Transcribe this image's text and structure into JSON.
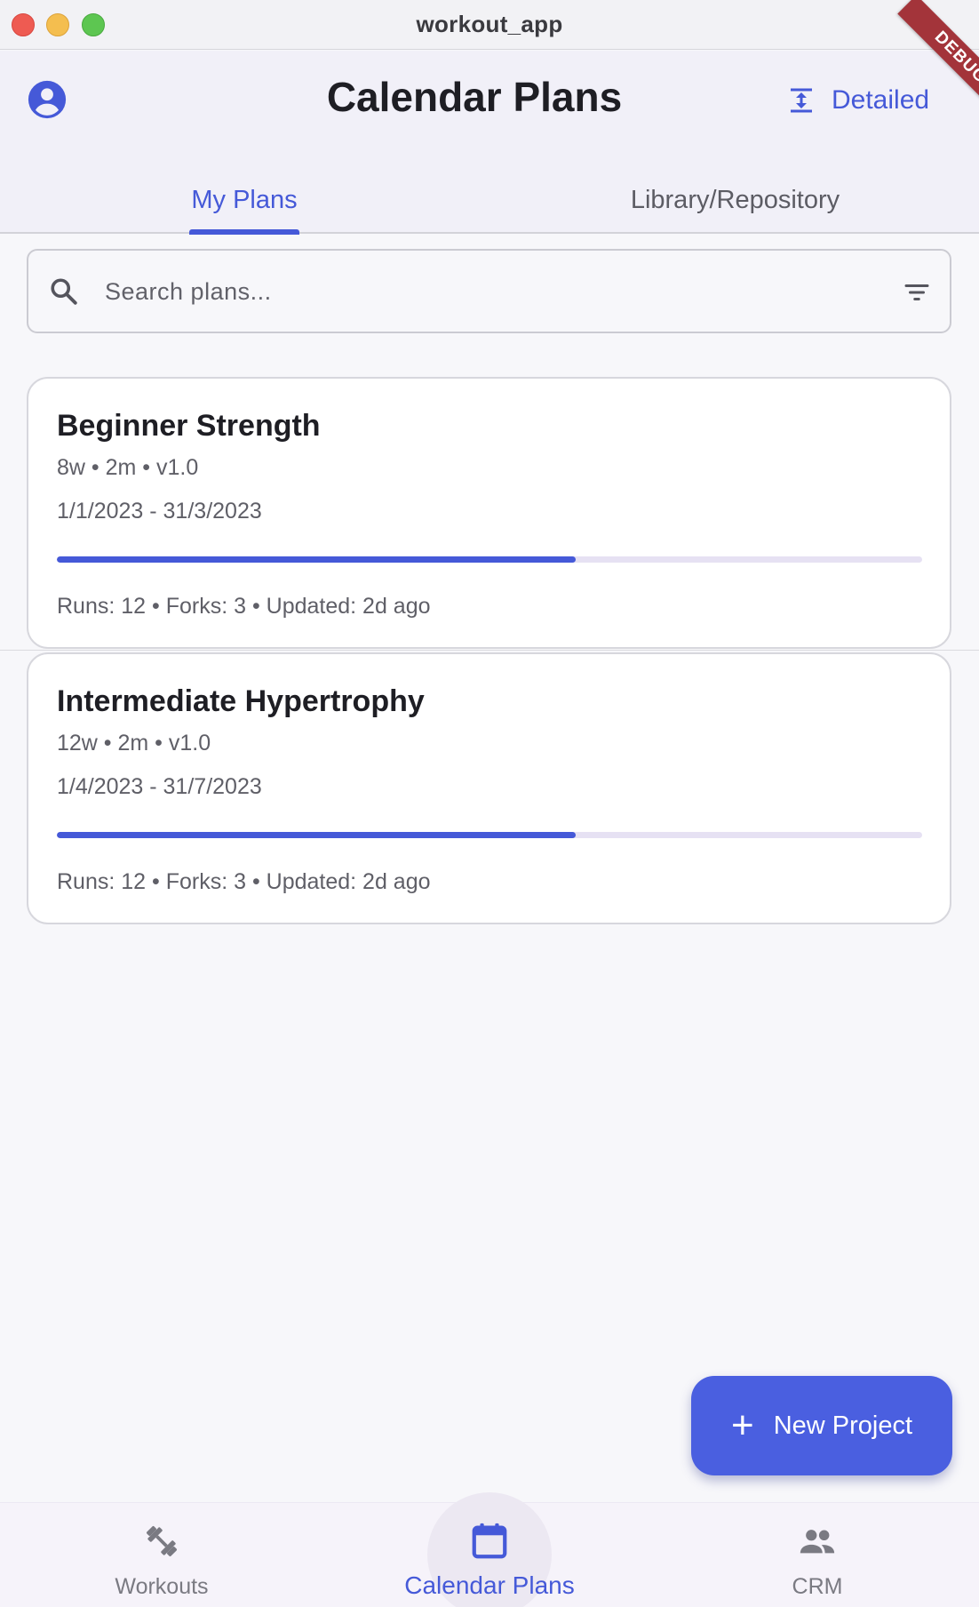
{
  "window": {
    "title": "workout_app"
  },
  "appbar": {
    "title": "Calendar Plans",
    "account_icon": "account-circle-icon",
    "detailed_label": "Detailed",
    "detailed_icon": "vertical-align-center-icon",
    "debug_banner": "DEBUG",
    "accent_color": "#4559d8"
  },
  "tabs": [
    {
      "label": "My Plans",
      "active": true
    },
    {
      "label": "Library/Repository",
      "active": false
    }
  ],
  "search": {
    "placeholder": "Search plans...",
    "value": ""
  },
  "plans": [
    {
      "title": "Beginner Strength",
      "meta": "8w • 2m • v1.0",
      "dates": "1/1/2023 - 31/3/2023",
      "progress": 0.6,
      "stats": "Runs: 12 • Forks: 3 • Updated: 2d ago"
    },
    {
      "title": "Intermediate Hypertrophy",
      "meta": "12w • 2m • v1.0",
      "dates": "1/4/2023 - 31/7/2023",
      "progress": 0.6,
      "stats": "Runs: 12 • Forks: 3 • Updated: 2d ago"
    }
  ],
  "fab": {
    "label": "New Project",
    "icon": "plus-icon"
  },
  "bottom_nav": [
    {
      "label": "Workouts",
      "icon": "dumbbell-icon",
      "active": false
    },
    {
      "label": "Calendar Plans",
      "icon": "calendar-icon",
      "active": true
    },
    {
      "label": "CRM",
      "icon": "people-icon",
      "active": false
    }
  ]
}
